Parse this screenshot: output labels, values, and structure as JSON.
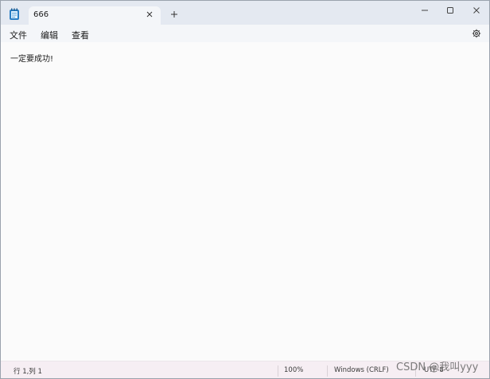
{
  "app": {
    "icon": "notepad-icon",
    "tab_title": "666"
  },
  "titlebar": {
    "new_tab_symbol": "+",
    "close_tab_symbol": "×"
  },
  "menu": {
    "file": "文件",
    "edit": "编辑",
    "view": "查看"
  },
  "editor": {
    "content": "一定要成功!"
  },
  "status": {
    "position": "行 1,列 1",
    "zoom": "100%",
    "line_ending": "Windows (CRLF)",
    "encoding": "UTF-8"
  },
  "watermark": "CSDN @我叫yyy",
  "colors": {
    "titlebar": "#e4e9f1",
    "menubar": "#f4f6f9",
    "editor": "#fbfbfb",
    "statusbar": "#f6eef3"
  }
}
